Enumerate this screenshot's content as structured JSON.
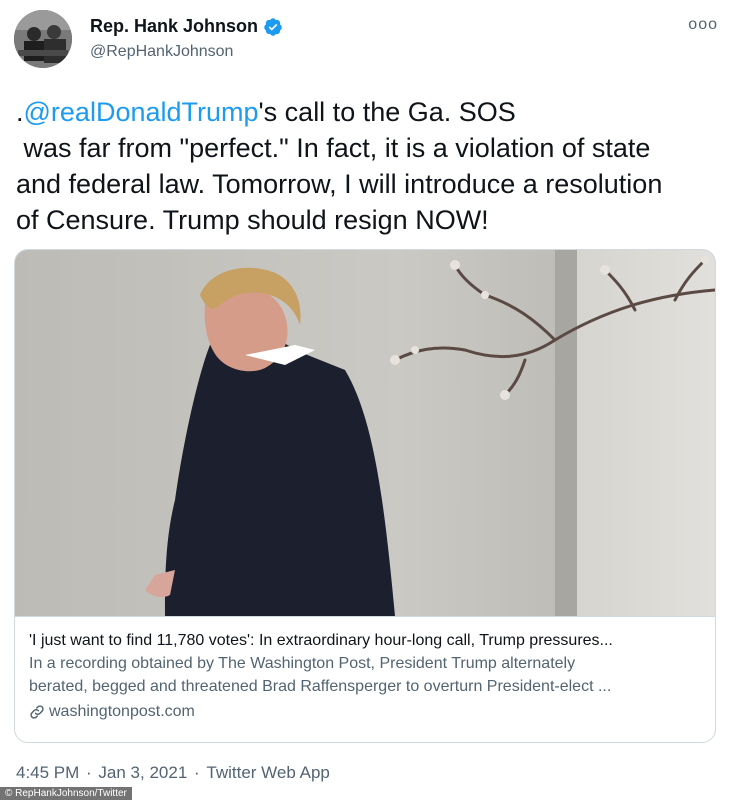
{
  "author": {
    "display_name": "Rep. Hank Johnson",
    "handle": "@RepHankJohnson",
    "verified_icon": "verified-badge-icon",
    "accent_color": "#1d9bf0"
  },
  "menu": {
    "more_label": "ooo"
  },
  "tweet": {
    "mention": "@realDonaldTrump",
    "line1_prefix": ".",
    "line1_suffix": "'s call to the Ga. SOS",
    "line2": " was far from \"perfect.\" In fact, it is a violation of state",
    "line3": "and federal law. Tomorrow, I will introduce a resolution",
    "line4": "of Censure. Trump should resign NOW!"
  },
  "card": {
    "title": "'I just want to find 11,780 votes': In extraordinary hour-long call, Trump pressures...",
    "description_line1": "In a recording obtained by The Washington Post, President Trump alternately",
    "description_line2": "berated, begged and threatened Brad Raffensperger to overturn President-elect ...",
    "domain": "washingtonpost.com",
    "link_icon": "link-icon"
  },
  "meta": {
    "time": "4:45 PM",
    "separator": " · ",
    "date": "Jan 3, 2021",
    "source": "Twitter Web App"
  },
  "watermark": {
    "text": "© RepHankJohnson/Twitter"
  }
}
